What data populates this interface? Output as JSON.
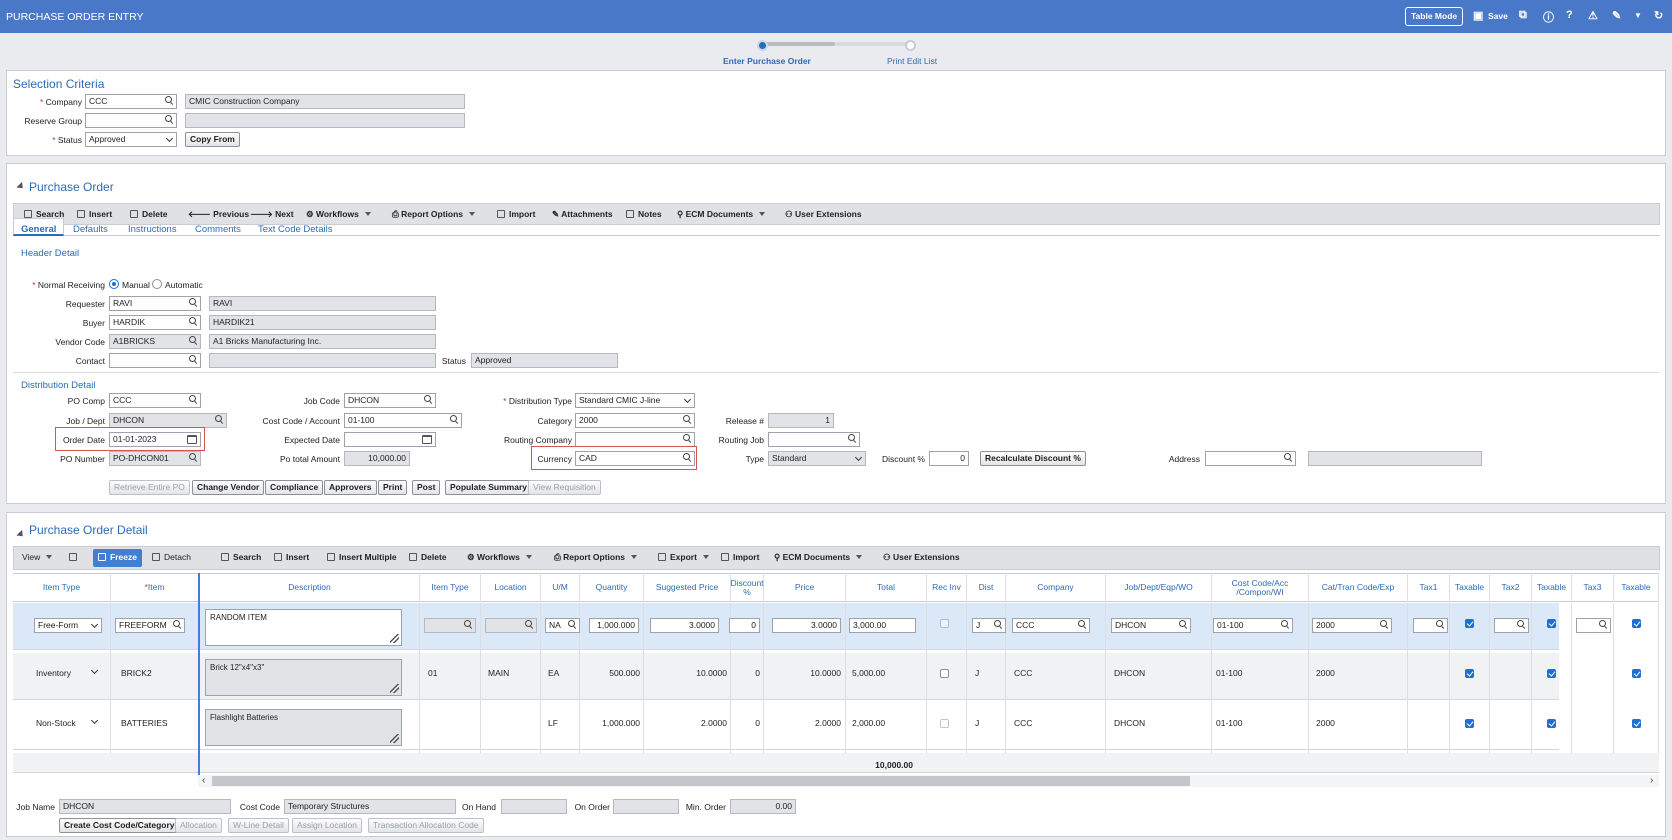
{
  "titlebar": {
    "title": "PURCHASE ORDER ENTRY",
    "table_mode": "Table Mode",
    "save": "Save"
  },
  "steps": {
    "step1": "Enter Purchase Order",
    "step2": "Print Edit List"
  },
  "selection": {
    "title": "Selection Criteria",
    "company_label": "Company",
    "company": "CCC",
    "company_name": "CMIC Construction Company",
    "reserve_label": "Reserve Group",
    "status_label": "Status",
    "status": "Approved",
    "copy_from": "Copy From"
  },
  "po": {
    "title": "Purchase Order",
    "toolbar": {
      "search": "Search",
      "insert": "Insert",
      "delete": "Delete",
      "previous": "Previous",
      "next": "Next",
      "workflows": "Workflows",
      "report": "Report Options",
      "import": "Import",
      "attachments": "Attachments",
      "notes": "Notes",
      "ecm": "ECM Documents",
      "userext": "User Extensions"
    },
    "tabs": {
      "general": "General",
      "defaults": "Defaults",
      "instructions": "Instructions",
      "comments": "Comments",
      "textcode": "Text Code Details"
    },
    "header_detail": "Header Detail",
    "normal_receiving": "Normal Receiving",
    "manual": "Manual",
    "automatic": "Automatic",
    "requester_label": "Requester",
    "requester": "RAVI",
    "requester_name": "RAVI",
    "buyer_label": "Buyer",
    "buyer": "HARDIK",
    "buyer_name": "HARDIK21",
    "vendor_label": "Vendor Code",
    "vendor": "A1BRICKS",
    "vendor_name": "A1 Bricks Manufacturing Inc.",
    "contact_label": "Contact",
    "status_label": "Status",
    "status": "Approved",
    "dist_detail": "Distribution Detail",
    "pocomp_label": "PO Comp",
    "pocomp": "CCC",
    "jobdept_label": "Job / Dept",
    "jobdept": "DHCON",
    "orderdate_label": "Order Date",
    "orderdate": "01-01-2023",
    "ponum_label": "PO Number",
    "ponum": "PO-DHCON01",
    "jobcode_label": "Job Code",
    "jobcode": "DHCON",
    "costcode_label": "Cost Code / Account",
    "costcode": "01-100",
    "expdate_label": "Expected Date",
    "pototal_label": "Po total Amount",
    "pototal": "10,000.00",
    "disttype_label": "Distribution Type",
    "disttype": "Standard CMIC J-line",
    "category_label": "Category",
    "category": "2000",
    "routingco_label": "Routing Company",
    "currency_label": "Currency",
    "currency": "CAD",
    "release_label": "Release #",
    "release": "1",
    "routingjob_label": "Routing Job",
    "type_label": "Type",
    "type": "Standard",
    "discount_label": "Discount %",
    "discount": "0",
    "recalc": "Recalculate Discount %",
    "address_label": "Address",
    "btns": {
      "retrieve": "Retrieve Entire PO",
      "change_vendor": "Change Vendor",
      "compliance": "Compliance",
      "approvers": "Approvers",
      "print": "Print",
      "post": "Post",
      "populate": "Populate Summary",
      "view_req": "View Requisition"
    }
  },
  "pod": {
    "title": "Purchase Order Detail",
    "toolbar": {
      "view": "View",
      "freeze": "Freeze",
      "detach": "Detach",
      "search": "Search",
      "insert": "Insert",
      "insert_multiple": "Insert Multiple",
      "delete": "Delete",
      "workflows": "Workflows",
      "report": "Report Options",
      "export": "Export",
      "import": "Import",
      "ecm": "ECM Documents",
      "userext": "User Extensions"
    },
    "columns": {
      "itemtype": "Item Type",
      "item": "Item",
      "description": "Description",
      "itemtype2": "Item Type",
      "location": "Location",
      "um": "U/M",
      "quantity": "Quantity",
      "sugprice": "Suggested Price",
      "discount": "Discount %",
      "price": "Price",
      "total": "Total",
      "recinv": "Rec Inv",
      "dist": "Dist",
      "company": "Company",
      "job": "Job/Dept/Eqp/WO",
      "costcode": "Cost Code/Acc /Compon/WI",
      "cattran": "Cat/Tran Code/Exp",
      "tax1": "Tax1",
      "taxable1": "Taxable",
      "tax2": "Tax2",
      "taxable2": "Taxable",
      "tax3": "Tax3",
      "taxable3": "Taxable"
    },
    "rows": [
      {
        "itemtype": "Free-Form",
        "item": "FREEFORM",
        "desc": "RANDOM ITEM",
        "itemtype2": "",
        "location": "",
        "um": "NA",
        "qty": "1,000.000",
        "sugprice": "3.0000",
        "disc": "0",
        "price": "3.0000",
        "total": "3,000.00",
        "dist": "J",
        "company": "CCC",
        "job": "DHCON",
        "costcode": "01-100",
        "cattran": "2000"
      },
      {
        "itemtype": "Inventory",
        "item": "BRICK2",
        "desc": "Brick 12\"x4\"x3\"",
        "itemtype2": "01",
        "location": "MAIN",
        "um": "EA",
        "qty": "500.000",
        "sugprice": "10.0000",
        "disc": "0",
        "price": "10.0000",
        "total": "5,000.00",
        "dist": "J",
        "company": "CCC",
        "job": "DHCON",
        "costcode": "01-100",
        "cattran": "2000"
      },
      {
        "itemtype": "Non-Stock",
        "item": "BATTERIES",
        "desc": "Flashlight Batteries",
        "itemtype2": "",
        "location": "",
        "um": "LF",
        "qty": "1,000.000",
        "sugprice": "2.0000",
        "disc": "0",
        "price": "2.0000",
        "total": "2,000.00",
        "dist": "J",
        "company": "CCC",
        "job": "DHCON",
        "costcode": "01-100",
        "cattran": "2000"
      }
    ],
    "grand_total": "10,000.00",
    "footer": {
      "jobname_label": "Job Name",
      "jobname": "DHCON",
      "costcode_label": "Cost Code",
      "costcode": "Temporary Structures",
      "onhand_label": "On Hand",
      "onorder_label": "On Order",
      "minorder_label": "Min. Order",
      "minorder": "0.00",
      "btns": {
        "create": "Create Cost Code/Category",
        "allocation": "Allocation",
        "wline": "W-Line Detail",
        "assign": "Assign Location",
        "trans": "Transaction Allocation Code"
      }
    }
  },
  "colors": {
    "accent": "#2d6bb5",
    "title_bar": "#4a78c8",
    "highlight": "#d9534f"
  }
}
